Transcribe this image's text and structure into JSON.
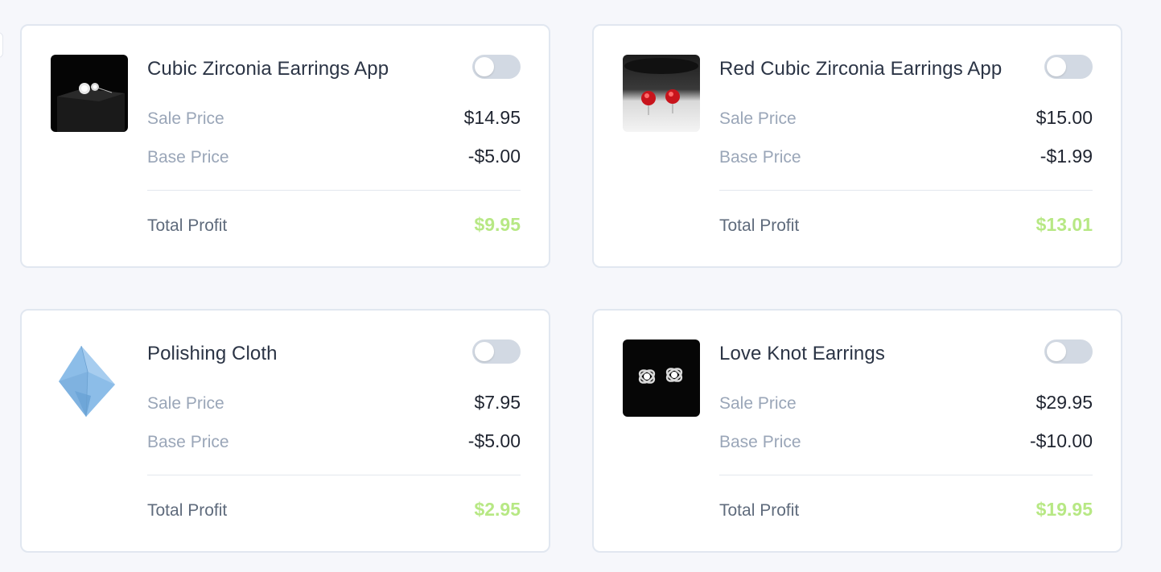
{
  "labels": {
    "sale": "Sale Price",
    "base": "Base Price",
    "total": "Total Profit"
  },
  "colors": {
    "profit": "#b7e884",
    "toggle_off": "#d2d9e3",
    "card_border": "#e1e7f0",
    "background": "#f6f7fb"
  },
  "products": [
    {
      "title": "Cubic Zirconia Earrings App",
      "sale_price": "$14.95",
      "base_price": "-$5.00",
      "total_profit": "$9.95",
      "enabled": false,
      "image": "cubic-zirconia-earrings-image"
    },
    {
      "title": "Red Cubic Zirconia Earrings App",
      "sale_price": "$15.00",
      "base_price": "-$1.99",
      "total_profit": "$13.01",
      "enabled": false,
      "image": "red-cubic-zirconia-earrings-image"
    },
    {
      "title": "Polishing Cloth",
      "sale_price": "$7.95",
      "base_price": "-$5.00",
      "total_profit": "$2.95",
      "enabled": false,
      "image": "polishing-cloth-image"
    },
    {
      "title": "Love Knot Earrings",
      "sale_price": "$29.95",
      "base_price": "-$10.00",
      "total_profit": "$19.95",
      "enabled": false,
      "image": "love-knot-earrings-image"
    }
  ]
}
